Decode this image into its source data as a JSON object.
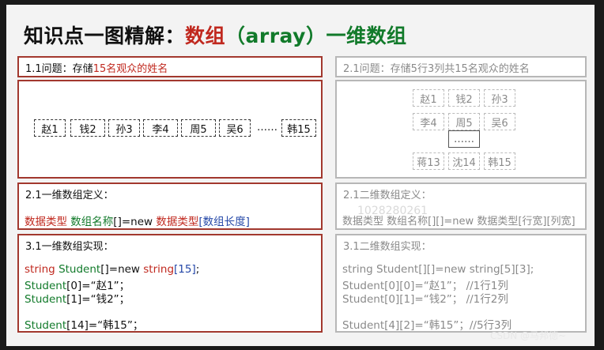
{
  "title": {
    "part1": "知识点一图精解：",
    "part2": "数组",
    "part3": "（array）",
    "part4": "一维数组"
  },
  "q1": {
    "label_prefix": "1.1问题：存储",
    "label_highlight": "15名观众的姓名",
    "cells": [
      "赵1",
      "钱2",
      "孙3",
      "李4",
      "周5",
      "吴6"
    ],
    "ellipsis": "……",
    "last": "韩15"
  },
  "def1": {
    "label": "2.1一维数组定义：",
    "type": "数据类型",
    "name": "数组名称",
    "mid": "[]=new ",
    "type2": "数据类型",
    "len": "[数组长度]"
  },
  "impl1": {
    "label": "3.1一维数组实现：",
    "line1": {
      "kw": "string",
      "name": "Student",
      "mid": "[]=new ",
      "kw2": "string",
      "len": "[15]",
      "end": ";"
    },
    "line2": {
      "name": "Student",
      "rest": "[0]=“赵1”；"
    },
    "line3": {
      "name": "Student",
      "rest": "[1]=“钱2”；"
    },
    "line4": {
      "name": "Student",
      "rest": "[14]=“韩15”；"
    }
  },
  "q2": {
    "label": "2.1问题：存储5行3列共15名观众的姓名",
    "grid": [
      [
        "赵1",
        "钱2",
        "孙3"
      ],
      [
        "李4",
        "周5",
        "吴6"
      ],
      [
        "蒋13",
        "沈14",
        "韩15"
      ]
    ],
    "ellipsis": "……"
  },
  "def2": {
    "label": "2.1二维数组定义：",
    "text": "数据类型 数组名称[][]=new 数据类型[行宽][列宽]"
  },
  "impl2": {
    "label": "3.1二维数组实现：",
    "lines": [
      "string  Student[][]=new string[5][3];",
      "Student[0][0]=“赵1”；  //1行1列",
      "Student[0][1]=“钱2”；  //1行2列",
      "Student[4][2]=“韩15”；//5行3列"
    ]
  },
  "watermark": "1028280261",
  "footer": "CSDN @马邦德~",
  "colors": {
    "red": "#c0281e",
    "green": "#117a2a",
    "blue": "#2548a8",
    "border_red": "#a2382e",
    "border_gray": "#b7b7b7"
  }
}
